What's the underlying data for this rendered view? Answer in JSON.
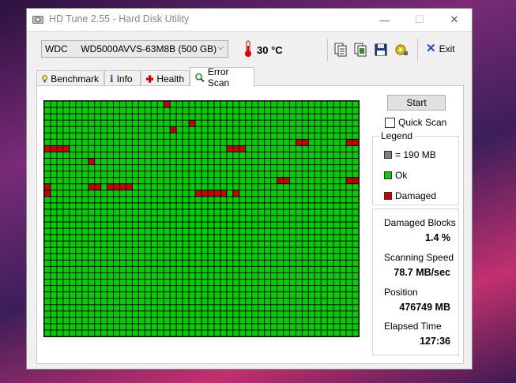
{
  "window": {
    "title": "HD Tune 2.55 - Hard Disk Utility"
  },
  "titlebar_buttons": {
    "minimize": "—",
    "maximize": "☐",
    "close": "✕"
  },
  "toolbar": {
    "drive": "WDC     WD5000AVVS-63M8B (500 GB)",
    "temperature": "30 °C",
    "exit_label": "Exit"
  },
  "tabs": [
    {
      "label": "Benchmark",
      "icon": "lightbulb-icon"
    },
    {
      "label": "Info",
      "icon": "info-icon"
    },
    {
      "label": "Health",
      "icon": "health-cross-icon"
    },
    {
      "label": "Error Scan",
      "icon": "magnifier-icon",
      "active": true
    }
  ],
  "controls": {
    "start_label": "Start",
    "quick_scan_label": "Quick Scan",
    "quick_scan_checked": false
  },
  "legend": {
    "title": "Legend",
    "block_size": "= 190 MB",
    "ok": "Ok",
    "damaged": "Damaged"
  },
  "stats": {
    "damaged_blocks_label": "Damaged Blocks",
    "damaged_blocks_value": "1.4 %",
    "speed_label": "Scanning Speed",
    "speed_value": "78.7 MB/sec",
    "position_label": "Position",
    "position_value": "476749 MB",
    "elapsed_label": "Elapsed Time",
    "elapsed_value": "127:36"
  },
  "colors": {
    "ok": "#00d000",
    "damaged": "#cc0000",
    "grid_line": "#000000",
    "legend_block": "#808080"
  },
  "scan_map": {
    "columns": 50,
    "rows": 37,
    "damaged_blocks": [
      [
        19,
        0
      ],
      [
        20,
        4
      ],
      [
        23,
        3
      ],
      [
        0,
        7
      ],
      [
        1,
        7
      ],
      [
        2,
        7
      ],
      [
        3,
        7
      ],
      [
        29,
        7
      ],
      [
        30,
        7
      ],
      [
        31,
        7
      ],
      [
        40,
        6
      ],
      [
        41,
        6
      ],
      [
        48,
        6
      ],
      [
        49,
        6
      ],
      [
        7,
        9
      ],
      [
        0,
        13
      ],
      [
        0,
        14
      ],
      [
        7,
        13
      ],
      [
        8,
        13
      ],
      [
        10,
        13
      ],
      [
        11,
        13
      ],
      [
        12,
        13
      ],
      [
        13,
        13
      ],
      [
        37,
        12
      ],
      [
        38,
        12
      ],
      [
        48,
        12
      ],
      [
        49,
        12
      ],
      [
        24,
        14
      ],
      [
        25,
        14
      ],
      [
        26,
        14
      ],
      [
        27,
        14
      ],
      [
        28,
        14
      ],
      [
        30,
        14
      ]
    ]
  }
}
